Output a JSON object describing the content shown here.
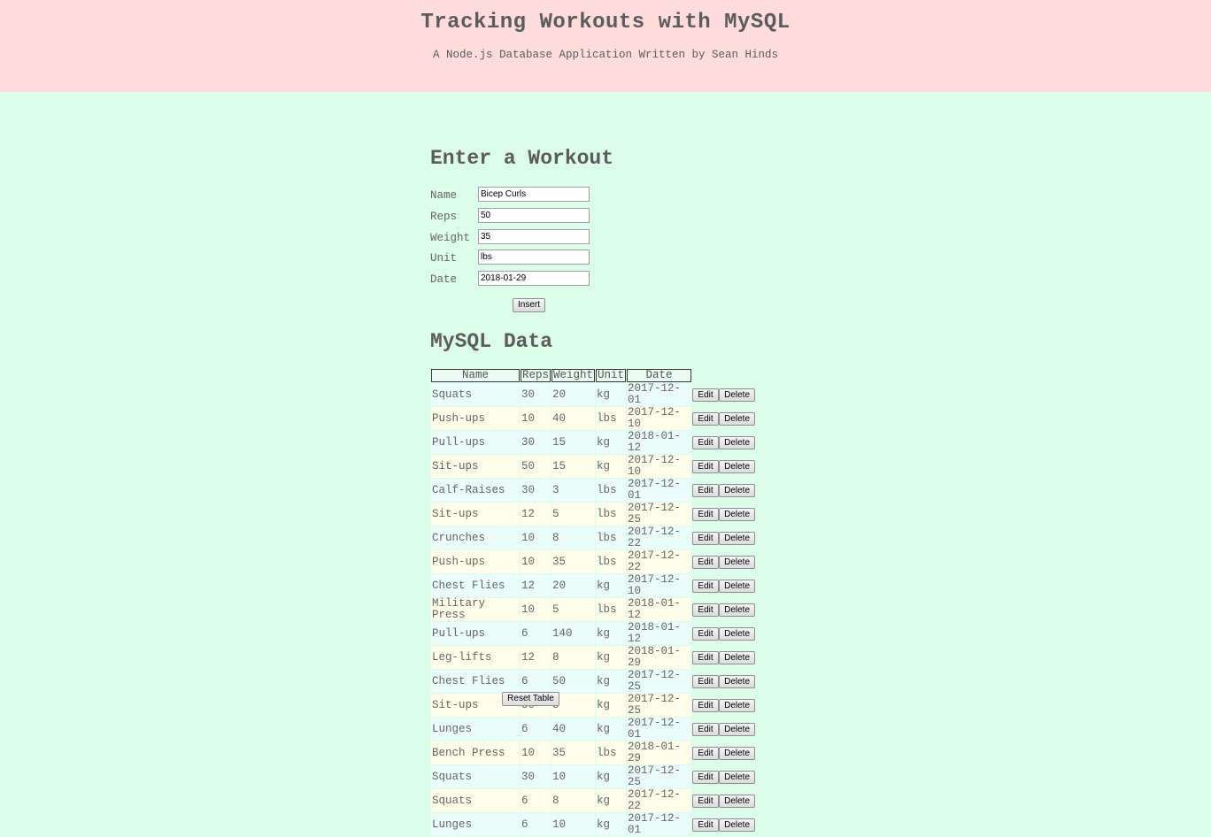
{
  "header": {
    "title": "Tracking Workouts with MySQL",
    "subtitle": "A Node.js Database Application Written by Sean Hinds"
  },
  "form": {
    "heading": "Enter a Workout",
    "fields": [
      {
        "label": "Name",
        "value": "Bicep Curls"
      },
      {
        "label": "Reps",
        "value": "50"
      },
      {
        "label": "Weight",
        "value": "35"
      },
      {
        "label": "Unit",
        "value": "lbs"
      },
      {
        "label": "Date",
        "value": "2018-01-29"
      }
    ],
    "insert_label": "Insert"
  },
  "data_section": {
    "heading": "MySQL Data",
    "columns": [
      "Name",
      "Reps",
      "Weight",
      "Unit",
      "Date"
    ],
    "edit_label": "Edit",
    "delete_label": "Delete",
    "rows": [
      [
        "Squats",
        "30",
        "20",
        "kg",
        "2017-12-01"
      ],
      [
        "Push-ups",
        "10",
        "40",
        "lbs",
        "2017-12-10"
      ],
      [
        "Pull-ups",
        "30",
        "15",
        "kg",
        "2018-01-12"
      ],
      [
        "Sit-ups",
        "50",
        "15",
        "kg",
        "2017-12-10"
      ],
      [
        "Calf-Raises",
        "30",
        "3",
        "lbs",
        "2017-12-01"
      ],
      [
        "Sit-ups",
        "12",
        "5",
        "lbs",
        "2017-12-25"
      ],
      [
        "Crunches",
        "10",
        "8",
        "lbs",
        "2017-12-22"
      ],
      [
        "Push-ups",
        "10",
        "35",
        "lbs",
        "2017-12-22"
      ],
      [
        "Chest Flies",
        "12",
        "20",
        "kg",
        "2017-12-10"
      ],
      [
        "Military Press",
        "10",
        "5",
        "lbs",
        "2018-01-12"
      ],
      [
        "Pull-ups",
        "6",
        "140",
        "kg",
        "2018-01-12"
      ],
      [
        "Leg-lifts",
        "12",
        "8",
        "kg",
        "2018-01-29"
      ],
      [
        "Chest Flies",
        "6",
        "50",
        "kg",
        "2017-12-25"
      ],
      [
        "Sit-ups",
        "50",
        "5",
        "kg",
        "2017-12-25"
      ],
      [
        "Lunges",
        "6",
        "40",
        "kg",
        "2017-12-01"
      ],
      [
        "Bench Press",
        "10",
        "35",
        "lbs",
        "2018-01-29"
      ],
      [
        "Squats",
        "30",
        "10",
        "kg",
        "2017-12-25"
      ],
      [
        "Squats",
        "6",
        "8",
        "kg",
        "2017-12-22"
      ],
      [
        "Lunges",
        "6",
        "10",
        "kg",
        "2017-12-01"
      ]
    ],
    "reset_label": "Reset Table"
  }
}
